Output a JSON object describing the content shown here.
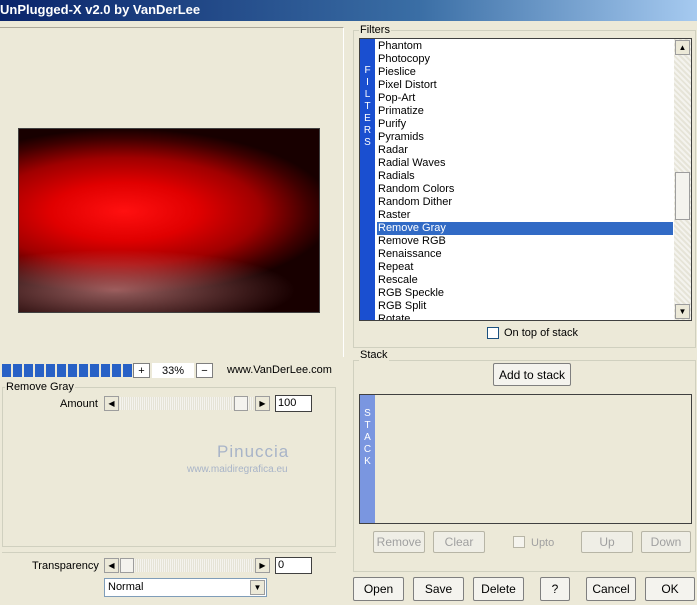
{
  "window": {
    "title": "UnPlugged-X v2.0 by VanDerLee"
  },
  "preview": {
    "zoom": "33%",
    "zoom_in_label": "+",
    "zoom_out_label": "−",
    "website": "www.VanDerLee.com",
    "progress_segments": 13
  },
  "filter_params": {
    "group_title": "Remove Gray",
    "amount_label": "Amount",
    "amount_value": "100",
    "amount_fraction": 0.95
  },
  "watermark": {
    "line1": "Pinuccia",
    "line2": "www.maidiregrafica.eu"
  },
  "transparency": {
    "label": "Transparency",
    "value": "0",
    "fraction": 0.0,
    "blend_mode": "Normal"
  },
  "filters": {
    "group_title": "Filters",
    "tab_letters": [
      "F",
      "I",
      "L",
      "T",
      "E",
      "R",
      "S"
    ],
    "items": [
      "Phantom",
      "Photocopy",
      "Pieslice",
      "Pixel Distort",
      "Pop-Art",
      "Primatize",
      "Purify",
      "Pyramids",
      "Radar",
      "Radial Waves",
      "Radials",
      "Random Colors",
      "Random Dither",
      "Raster",
      "Remove Gray",
      "Remove RGB",
      "Renaissance",
      "Repeat",
      "Rescale",
      "RGB Speckle",
      "RGB Split",
      "Rotate"
    ],
    "selected": "Remove Gray",
    "on_top_label": "On top of stack"
  },
  "stack": {
    "group_title": "Stack",
    "add_label": "Add to stack",
    "tab_letters": [
      "S",
      "T",
      "A",
      "C",
      "K"
    ],
    "remove_label": "Remove",
    "clear_label": "Clear",
    "upto_label": "Upto",
    "up_label": "Up",
    "down_label": "Down"
  },
  "actions": {
    "open": "Open",
    "save": "Save",
    "delete": "Delete",
    "help": "?",
    "cancel": "Cancel",
    "ok": "OK"
  },
  "icons": {
    "scroll_up": "▲",
    "scroll_down": "▼",
    "slider_left": "◀",
    "slider_right": "▶",
    "dropdown": "▼"
  },
  "colors": {
    "selection": "#316ac5",
    "filter_tab": "#1a4fd0",
    "stack_tab": "#7a96e0",
    "progress": "#2861c6"
  }
}
